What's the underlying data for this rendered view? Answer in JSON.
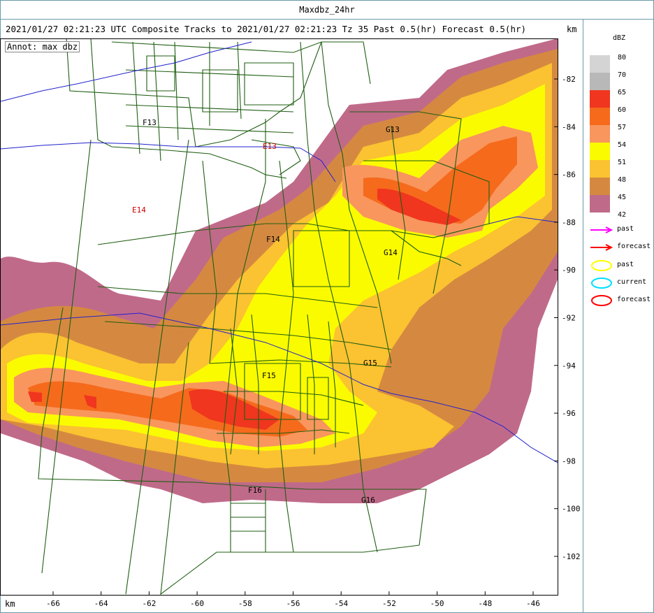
{
  "window_title": "Maxdbz_24hr",
  "header": "2021/01/27 02:21:23 UTC Composite Tracks to 2021/01/27 02:21:23 Tz 35 Past 0.5(hr) Forecast 0.5(hr)",
  "annotation": "Annot: max dbz",
  "unit_label": "km",
  "x_ticks": [
    "-66",
    "-64",
    "-62",
    "-60",
    "-58",
    "-56",
    "-54",
    "-52",
    "-50",
    "-48",
    "-46"
  ],
  "y_ticks": [
    "-82",
    "-84",
    "-86",
    "-88",
    "-90",
    "-92",
    "-94",
    "-96",
    "-98",
    "-100",
    "-102"
  ],
  "legend": {
    "title": "dBZ",
    "levels": [
      {
        "value": "80",
        "color": "#d4d4d4"
      },
      {
        "value": "70",
        "color": "#b8b8b8"
      },
      {
        "value": "65",
        "color": "#f0361e"
      },
      {
        "value": "60",
        "color": "#f66a1c"
      },
      {
        "value": "57",
        "color": "#f8965e"
      },
      {
        "value": "54",
        "color": "#fbfb00"
      },
      {
        "value": "51",
        "color": "#fbc231"
      },
      {
        "value": "48",
        "color": "#d58940"
      },
      {
        "value": "45",
        "color": "#c06a8a"
      },
      {
        "value": "42",
        "color": ""
      }
    ],
    "arrows": [
      {
        "label": "past",
        "color": "#ff00ff"
      },
      {
        "label": "forecast",
        "color": "#ff0000"
      }
    ],
    "ellipses": [
      {
        "label": "past",
        "color": "#ffff00"
      },
      {
        "label": "current",
        "color": "#00e0ff"
      },
      {
        "label": "forecast",
        "color": "#ff0000"
      }
    ]
  },
  "storm_labels": [
    {
      "text": "F13",
      "color": "#000000"
    },
    {
      "text": "E13",
      "color": "#cc0000"
    },
    {
      "text": "G13",
      "color": "#000000"
    },
    {
      "text": "E14",
      "color": "#cc0000"
    },
    {
      "text": "F14",
      "color": "#000000"
    },
    {
      "text": "G14",
      "color": "#000000"
    },
    {
      "text": "F15",
      "color": "#000000"
    },
    {
      "text": "G15",
      "color": "#000000"
    },
    {
      "text": "F16",
      "color": "#000000"
    },
    {
      "text": "G16",
      "color": "#000000"
    }
  ],
  "colors": {
    "road": "#1f5e12",
    "boundary": "#2222cc",
    "frame": "#6a9aa6"
  }
}
